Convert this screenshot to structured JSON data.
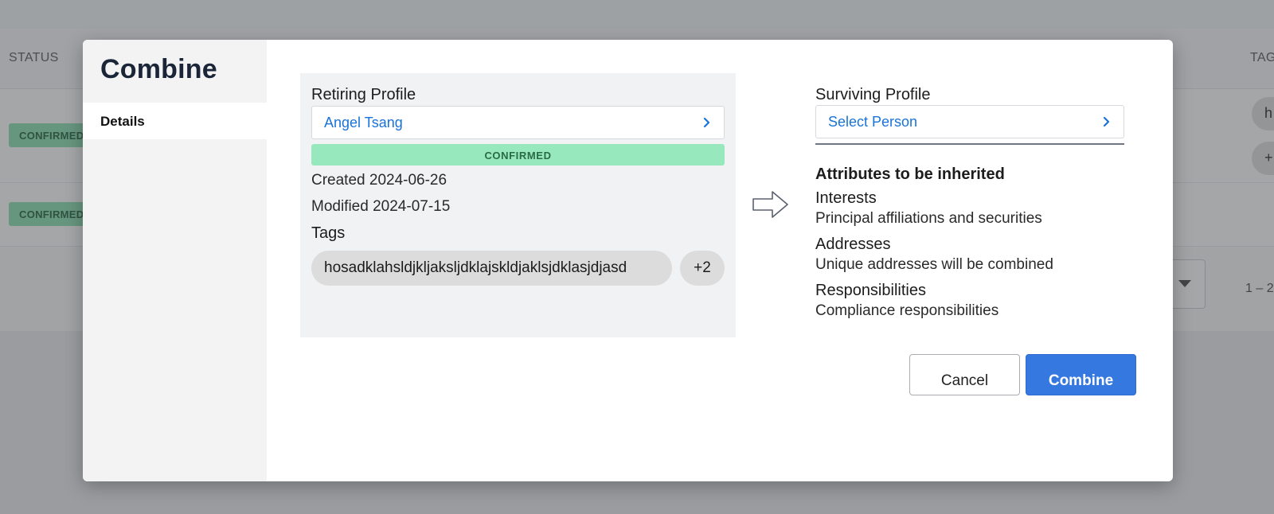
{
  "background": {
    "status_header": "STATUS",
    "tags_header": "TAG",
    "row_badges": [
      "CONFIRMED",
      "CONFIRMED"
    ],
    "row_chips": [
      "h",
      "+"
    ],
    "pagination": "1 – 2"
  },
  "modal": {
    "title": "Combine",
    "sidebar_tabs": [
      {
        "label": "Details"
      }
    ],
    "retiring": {
      "label": "Retiring Profile",
      "person": "Angel Tsang",
      "status": "CONFIRMED",
      "created": "Created 2024-06-26",
      "modified": "Modified 2024-07-15",
      "tags_label": "Tags",
      "tag": "hosadklahsldjkljaksljdklajskldjaklsjdklasjdjasd",
      "more_tags": "+2"
    },
    "surviving": {
      "label": "Surviving Profile",
      "placeholder": "Select Person"
    },
    "attributes": {
      "heading": "Attributes to be inherited",
      "items": [
        {
          "title": "Interests",
          "description": "Principal affiliations and securities"
        },
        {
          "title": "Addresses",
          "description": "Unique addresses will be combined"
        },
        {
          "title": "Responsibilities",
          "description": "Compliance responsibilities"
        }
      ]
    },
    "buttons": {
      "cancel": "Cancel",
      "combine": "Combine"
    }
  },
  "colors": {
    "primary": "#3478e0",
    "link": "#1a73d9",
    "confirmed_bg": "#97e8bc",
    "confirmed_text": "#2a6b46",
    "title": "#1a2638"
  },
  "icons": {
    "select_chevron": "chevron-right-icon",
    "transfer_arrow": "arrow-right-icon",
    "dropdown_caret": "caret-down-icon"
  }
}
